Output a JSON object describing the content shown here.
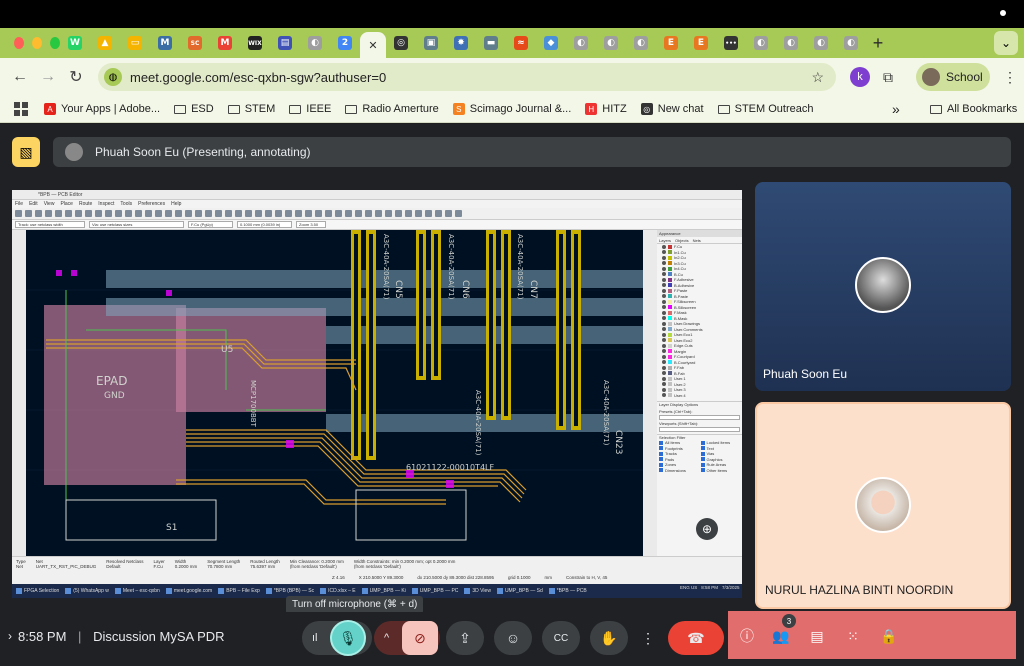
{
  "browser": {
    "tab_favicons": [
      {
        "name": "whatsapp",
        "color": "#25d366",
        "glyph": "W"
      },
      {
        "name": "drive",
        "color": "#f4b400",
        "glyph": "▲"
      },
      {
        "name": "slides",
        "color": "#f4b400",
        "glyph": "▭"
      },
      {
        "name": "mendeley",
        "color": "#3b6ea5",
        "glyph": "M"
      },
      {
        "name": "sc",
        "color": "#e26a2c",
        "glyph": "SC"
      },
      {
        "name": "gmail",
        "color": "#ea4335",
        "glyph": "M"
      },
      {
        "name": "wix",
        "color": "#222",
        "glyph": "WIX"
      },
      {
        "name": "forms",
        "color": "#3f51b5",
        "glyph": "▤"
      },
      {
        "name": "generic",
        "color": "#9e9e9e",
        "glyph": "◐"
      },
      {
        "name": "calendar",
        "color": "#4285f4",
        "glyph": "2"
      }
    ],
    "active_tab_close": "✕",
    "tab_favicons_right": [
      {
        "name": "chatgpt",
        "color": "#333",
        "glyph": "◎"
      },
      {
        "name": "pdf",
        "color": "#607d8b",
        "glyph": "▣"
      },
      {
        "name": "settings",
        "color": "#3f6fb5",
        "glyph": "✸"
      },
      {
        "name": "meet",
        "color": "#607d8b",
        "glyph": "▬"
      },
      {
        "name": "fish",
        "color": "#e64a19",
        "glyph": "≈"
      },
      {
        "name": "drive2",
        "color": "#4a8fd8",
        "glyph": "◆"
      },
      {
        "name": "generic",
        "color": "#9e9e9e",
        "glyph": "◐"
      },
      {
        "name": "generic",
        "color": "#9e9e9e",
        "glyph": "◐"
      },
      {
        "name": "generic",
        "color": "#9e9e9e",
        "glyph": "◐"
      },
      {
        "name": "etsy",
        "color": "#e87722",
        "glyph": "E"
      },
      {
        "name": "etsy",
        "color": "#e87722",
        "glyph": "E"
      },
      {
        "name": "dots",
        "color": "#333",
        "glyph": "•••"
      },
      {
        "name": "generic",
        "color": "#9e9e9e",
        "glyph": "◐"
      },
      {
        "name": "generic",
        "color": "#9e9e9e",
        "glyph": "◐"
      },
      {
        "name": "generic",
        "color": "#9e9e9e",
        "glyph": "◐"
      },
      {
        "name": "generic",
        "color": "#9e9e9e",
        "glyph": "◐"
      }
    ],
    "new_tab": "+",
    "url": "meet.google.com/esc-qxbn-sgw?authuser=0",
    "profile_label": "School",
    "bookmarks": [
      {
        "label": "Your Apps | Adobe...",
        "icon": "adobe-icon"
      },
      {
        "label": "ESD",
        "icon": "folder-icon"
      },
      {
        "label": "STEM",
        "icon": "folder-icon"
      },
      {
        "label": "IEEE",
        "icon": "folder-icon"
      },
      {
        "label": "Radio Amerture",
        "icon": "folder-icon"
      },
      {
        "label": "Scimago Journal &...",
        "icon": "sjr-icon"
      },
      {
        "label": "HITZ",
        "icon": "hitz-icon"
      },
      {
        "label": "New chat",
        "icon": "chatgpt-icon"
      },
      {
        "label": "STEM Outreach",
        "icon": "folder-icon"
      }
    ],
    "bookmarks_overflow": "»",
    "all_bookmarks": "All Bookmarks"
  },
  "meet": {
    "presenter_banner": "Phuah Soon Eu (Presenting, annotating)",
    "participants": [
      {
        "name": "Phuah Soon Eu"
      },
      {
        "name": "NURUL HAZLINA BINTI NOORDIN"
      }
    ],
    "time": "8:58 PM",
    "separator": "|",
    "meeting_title": "Discussion MySA PDR",
    "mic_tooltip": "Turn off microphone (⌘ + d)",
    "people_count": "3"
  },
  "shared_screen": {
    "window_title": "*BPB — PCB Editor",
    "menu": [
      "File",
      "Edit",
      "View",
      "Place",
      "Route",
      "Inspect",
      "Tools",
      "Preferences",
      "Help"
    ],
    "track_select": "Track: use netclass width",
    "via_select": "Via: use netclass sizes",
    "layer_select": "F.Cu (PgUp)",
    "grid_select": "0.1000 mm (0.0039 in)",
    "zoom_select": "Zoom 3.50",
    "panel_title": "Appearance",
    "panel_tabs": [
      "Layers",
      "Objects",
      "Nets"
    ],
    "layers": [
      {
        "name": "F.Cu",
        "color": "#c83434"
      },
      {
        "name": "In1.Cu",
        "color": "#7f9f2f"
      },
      {
        "name": "In2.Cu",
        "color": "#c2c200"
      },
      {
        "name": "In3.Cu",
        "color": "#c27f00"
      },
      {
        "name": "In4.Cu",
        "color": "#3f9f3f"
      },
      {
        "name": "B.Cu",
        "color": "#4d7fc4"
      },
      {
        "name": "F.Adhesive",
        "color": "#843184"
      },
      {
        "name": "B.Adhesive",
        "color": "#3e3eb5"
      },
      {
        "name": "F.Paste",
        "color": "#b2617f"
      },
      {
        "name": "B.Paste",
        "color": "#2db2b2"
      },
      {
        "name": "F.Silkscreen",
        "color": "#f2eda1"
      },
      {
        "name": "B.Silkscreen",
        "color": "#e800ff"
      },
      {
        "name": "F.Mask",
        "color": "#d86c6c"
      },
      {
        "name": "B.Mask",
        "color": "#02ffee"
      },
      {
        "name": "User.Drawings",
        "color": "#c2c2c2"
      },
      {
        "name": "User.Comments",
        "color": "#7faacb"
      },
      {
        "name": "User.Eco1",
        "color": "#b4db3d"
      },
      {
        "name": "User.Eco2",
        "color": "#d8c852"
      },
      {
        "name": "Edge.Cuts",
        "color": "#d0d2cd"
      },
      {
        "name": "Margin",
        "color": "#ff26e2"
      },
      {
        "name": "F.Courtyard",
        "color": "#ff26e2"
      },
      {
        "name": "B.Courtyard",
        "color": "#26e9ff"
      },
      {
        "name": "F.Fab",
        "color": "#afafaf"
      },
      {
        "name": "B.Fab",
        "color": "#585d84"
      },
      {
        "name": "User.1",
        "color": "#c2c2c2"
      },
      {
        "name": "User.2",
        "color": "#c2c2c2"
      },
      {
        "name": "User.3",
        "color": "#c2c2c2"
      },
      {
        "name": "User.4",
        "color": "#c2c2c2"
      }
    ],
    "layer_display_options": "Layer Display Options",
    "presets_label": "Presets (Ctrl+Tab):",
    "viewports_label": "Viewports (Shift+Tab):",
    "selection_filter": "Selection Filter",
    "filter_items": [
      "All items",
      "Locked items",
      "Footprints",
      "Text",
      "Tracks",
      "Vias",
      "Pads",
      "Graphics",
      "Zones",
      "Rule Areas",
      "Dimensions",
      "Other items"
    ],
    "pcb_labels": [
      "EPAD",
      "GND",
      "U5",
      "CN5",
      "CN6",
      "CN7",
      "CN23",
      "S1",
      "A3C-40A-20SA(71)",
      "A3C-40A-20SA(71)",
      "A3C-40A-20SA(71)",
      "A3C-40A-20SA(71)",
      "61021122-00010T4LF",
      "MCP1700BBT",
      "A3C-40A-20SA(71)"
    ],
    "status": {
      "type_label": "Type",
      "type_value": "Net",
      "net_label": "Net",
      "net_value": "UART_TX_RST_PIC_DEBUG",
      "resolved_label": "Resolved Netclass",
      "resolved_value": "Default",
      "layer_label": "Layer",
      "layer_value": "F.Cu",
      "width_label": "Width",
      "width_value": "0.2000 mm",
      "seglen_label": "Segment Length",
      "seglen_value": "70.7800 mm",
      "routed_label": "Routed Length",
      "routed_value": "75.6397 mm",
      "minclear_label": "Min Clearance: 0.2000 mm",
      "minclear_value": "(from netclass 'Default')",
      "widthc_label": "Width Constraints: min 0.2000 mm; opt 0.2000 mm",
      "widthc_value": "(from netclass 'Default')",
      "zoom": "Z 4.16",
      "xy": "X 210.5000  Y 89.3000",
      "dxy": "dx 210.5000  dy 89.3000  dist 228.8595",
      "grid": "grid 0.1000",
      "units": "mm",
      "constrain": "Constrain to H, V, 45"
    },
    "taskbar_items": [
      "FPGA Selection",
      "(5) WhatsApp w",
      "Meet – esc-qxbn",
      "meet.google.com",
      "BPB – File Exp",
      "*BPB (BPB) — Sc",
      "ICD.xlsx – E",
      "UMP_BPB — Ki",
      "UMP_BPB — PC",
      "3D View",
      "UMP_BPB — Sd",
      "*BPB — PCB"
    ],
    "taskbar_time": "8:58 PM",
    "taskbar_date": "7/3/2025",
    "taskbar_lang": "ENG US"
  },
  "colors": {
    "tab_bg": "#a7c956",
    "toolbar_bg": "#f3f7e8",
    "meet_bg": "#202124",
    "end_call": "#ea4335",
    "mic_active": "#64d2c8",
    "right_panel": "#e26d6d"
  }
}
